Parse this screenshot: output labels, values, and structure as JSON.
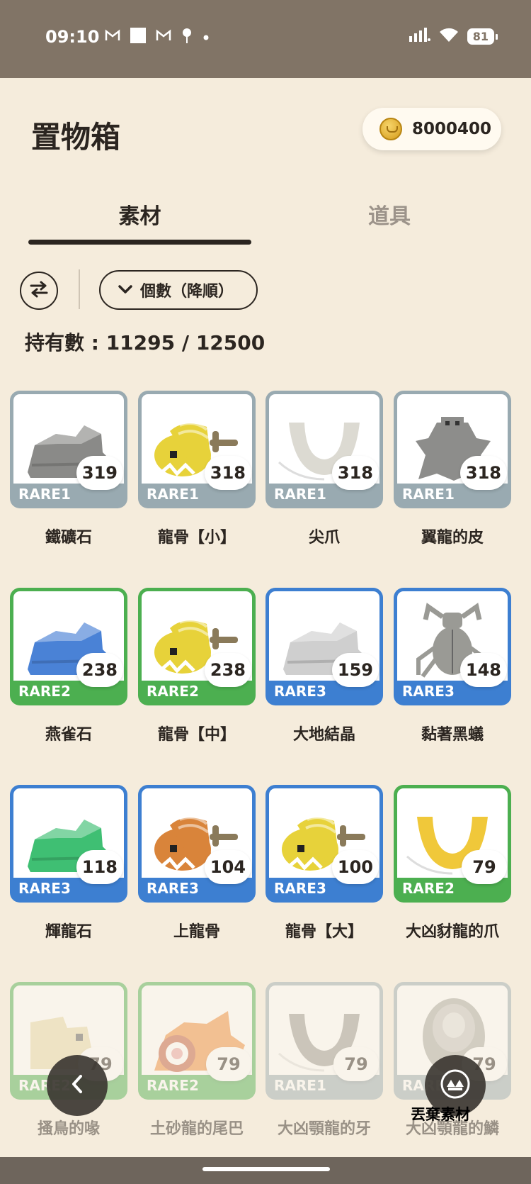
{
  "status_bar": {
    "time": "09:10",
    "battery": "81",
    "left_icons": [
      "gmail-icon",
      "square-icon",
      "gmail-icon",
      "location-pin-icon",
      "dot-icon"
    ],
    "right_icons": [
      "signal-icon",
      "wifi-icon"
    ]
  },
  "header": {
    "title": "置物箱",
    "coins": "8000400"
  },
  "tabs": [
    {
      "label": "素材",
      "active": true
    },
    {
      "label": "道具",
      "active": false
    }
  ],
  "toolbar": {
    "sort_label": "個數（降順）"
  },
  "hold_count": "持有數 : 11295 / 12500",
  "colors": {
    "RARE1": "#99aab1",
    "RARE2": "#4caf50",
    "RARE3": "#3d7fd1"
  },
  "items": [
    {
      "name": "鐵礦石",
      "count": "319",
      "rarity": "RARE1",
      "icon": "ore-icon",
      "tint": "#8a8a88"
    },
    {
      "name": "龍骨【小】",
      "count": "318",
      "rarity": "RARE1",
      "icon": "dragon-bone-icon",
      "tint": "#e7d23a"
    },
    {
      "name": "尖爪",
      "count": "318",
      "rarity": "RARE1",
      "icon": "claw-icon",
      "tint": "#dcdad2"
    },
    {
      "name": "翼龍的皮",
      "count": "318",
      "rarity": "RARE1",
      "icon": "hide-icon",
      "tint": "#8d8d8b"
    },
    {
      "name": "燕雀石",
      "count": "238",
      "rarity": "RARE2",
      "icon": "ore-icon",
      "tint": "#4a82d6"
    },
    {
      "name": "龍骨【中】",
      "count": "238",
      "rarity": "RARE2",
      "icon": "dragon-bone-icon",
      "tint": "#e7d23a"
    },
    {
      "name": "大地結晶",
      "count": "159",
      "rarity": "RARE3",
      "icon": "ore-icon",
      "tint": "#cfcfcf"
    },
    {
      "name": "黏著黑蟻",
      "count": "148",
      "rarity": "RARE3",
      "icon": "beetle-icon",
      "tint": "#9a9a95"
    },
    {
      "name": "輝龍石",
      "count": "118",
      "rarity": "RARE3",
      "icon": "ore-icon",
      "tint": "#3fbf73"
    },
    {
      "name": "上龍骨",
      "count": "104",
      "rarity": "RARE3",
      "icon": "dragon-bone-icon",
      "tint": "#d9843a"
    },
    {
      "name": "龍骨【大】",
      "count": "100",
      "rarity": "RARE3",
      "icon": "dragon-bone-icon",
      "tint": "#e7d23a"
    },
    {
      "name": "大凶豺龍的爪",
      "count": "79",
      "rarity": "RARE2",
      "icon": "claw-icon",
      "tint": "#f0c83a"
    },
    {
      "name": "搔鳥的喙",
      "count": "79",
      "rarity": "RARE2",
      "icon": "beak-icon",
      "tint": "#e6d9a8"
    },
    {
      "name": "土砂龍的尾巴",
      "count": "79",
      "rarity": "RARE2",
      "icon": "tail-icon",
      "tint": "#ef8c3a"
    },
    {
      "name": "大凶顎龍的牙",
      "count": "79",
      "rarity": "RARE1",
      "icon": "claw-icon",
      "tint": "#9a9892"
    },
    {
      "name": "大凶顎龍的鱗",
      "count": "79",
      "rarity": "RARE1",
      "icon": "scale-icon",
      "tint": "#a9a8a2"
    }
  ],
  "bottom": {
    "discard_label": "丟棄素材"
  }
}
